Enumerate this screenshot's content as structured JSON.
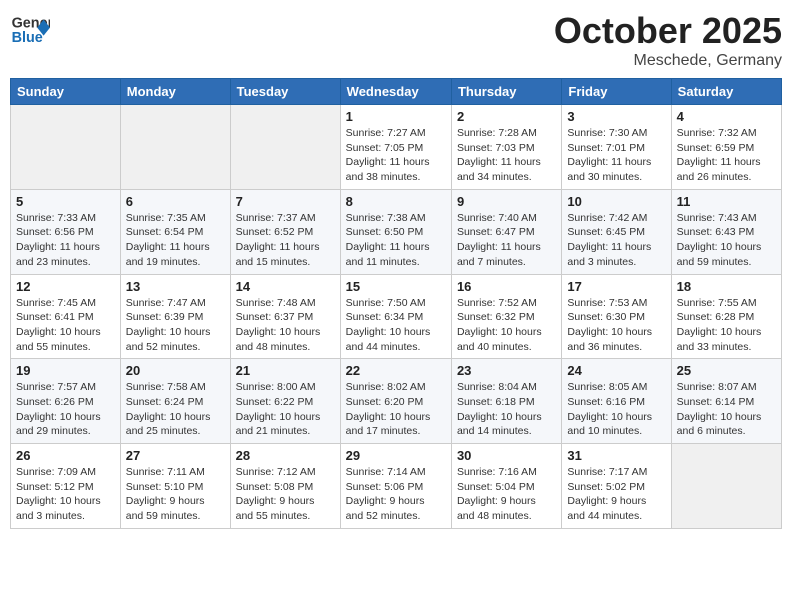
{
  "header": {
    "logo_general": "General",
    "logo_blue": "Blue",
    "month": "October 2025",
    "location": "Meschede, Germany"
  },
  "days_of_week": [
    "Sunday",
    "Monday",
    "Tuesday",
    "Wednesday",
    "Thursday",
    "Friday",
    "Saturday"
  ],
  "weeks": [
    [
      {
        "day": "",
        "info": ""
      },
      {
        "day": "",
        "info": ""
      },
      {
        "day": "",
        "info": ""
      },
      {
        "day": "1",
        "info": "Sunrise: 7:27 AM\nSunset: 7:05 PM\nDaylight: 11 hours\nand 38 minutes."
      },
      {
        "day": "2",
        "info": "Sunrise: 7:28 AM\nSunset: 7:03 PM\nDaylight: 11 hours\nand 34 minutes."
      },
      {
        "day": "3",
        "info": "Sunrise: 7:30 AM\nSunset: 7:01 PM\nDaylight: 11 hours\nand 30 minutes."
      },
      {
        "day": "4",
        "info": "Sunrise: 7:32 AM\nSunset: 6:59 PM\nDaylight: 11 hours\nand 26 minutes."
      }
    ],
    [
      {
        "day": "5",
        "info": "Sunrise: 7:33 AM\nSunset: 6:56 PM\nDaylight: 11 hours\nand 23 minutes."
      },
      {
        "day": "6",
        "info": "Sunrise: 7:35 AM\nSunset: 6:54 PM\nDaylight: 11 hours\nand 19 minutes."
      },
      {
        "day": "7",
        "info": "Sunrise: 7:37 AM\nSunset: 6:52 PM\nDaylight: 11 hours\nand 15 minutes."
      },
      {
        "day": "8",
        "info": "Sunrise: 7:38 AM\nSunset: 6:50 PM\nDaylight: 11 hours\nand 11 minutes."
      },
      {
        "day": "9",
        "info": "Sunrise: 7:40 AM\nSunset: 6:47 PM\nDaylight: 11 hours\nand 7 minutes."
      },
      {
        "day": "10",
        "info": "Sunrise: 7:42 AM\nSunset: 6:45 PM\nDaylight: 11 hours\nand 3 minutes."
      },
      {
        "day": "11",
        "info": "Sunrise: 7:43 AM\nSunset: 6:43 PM\nDaylight: 10 hours\nand 59 minutes."
      }
    ],
    [
      {
        "day": "12",
        "info": "Sunrise: 7:45 AM\nSunset: 6:41 PM\nDaylight: 10 hours\nand 55 minutes."
      },
      {
        "day": "13",
        "info": "Sunrise: 7:47 AM\nSunset: 6:39 PM\nDaylight: 10 hours\nand 52 minutes."
      },
      {
        "day": "14",
        "info": "Sunrise: 7:48 AM\nSunset: 6:37 PM\nDaylight: 10 hours\nand 48 minutes."
      },
      {
        "day": "15",
        "info": "Sunrise: 7:50 AM\nSunset: 6:34 PM\nDaylight: 10 hours\nand 44 minutes."
      },
      {
        "day": "16",
        "info": "Sunrise: 7:52 AM\nSunset: 6:32 PM\nDaylight: 10 hours\nand 40 minutes."
      },
      {
        "day": "17",
        "info": "Sunrise: 7:53 AM\nSunset: 6:30 PM\nDaylight: 10 hours\nand 36 minutes."
      },
      {
        "day": "18",
        "info": "Sunrise: 7:55 AM\nSunset: 6:28 PM\nDaylight: 10 hours\nand 33 minutes."
      }
    ],
    [
      {
        "day": "19",
        "info": "Sunrise: 7:57 AM\nSunset: 6:26 PM\nDaylight: 10 hours\nand 29 minutes."
      },
      {
        "day": "20",
        "info": "Sunrise: 7:58 AM\nSunset: 6:24 PM\nDaylight: 10 hours\nand 25 minutes."
      },
      {
        "day": "21",
        "info": "Sunrise: 8:00 AM\nSunset: 6:22 PM\nDaylight: 10 hours\nand 21 minutes."
      },
      {
        "day": "22",
        "info": "Sunrise: 8:02 AM\nSunset: 6:20 PM\nDaylight: 10 hours\nand 17 minutes."
      },
      {
        "day": "23",
        "info": "Sunrise: 8:04 AM\nSunset: 6:18 PM\nDaylight: 10 hours\nand 14 minutes."
      },
      {
        "day": "24",
        "info": "Sunrise: 8:05 AM\nSunset: 6:16 PM\nDaylight: 10 hours\nand 10 minutes."
      },
      {
        "day": "25",
        "info": "Sunrise: 8:07 AM\nSunset: 6:14 PM\nDaylight: 10 hours\nand 6 minutes."
      }
    ],
    [
      {
        "day": "26",
        "info": "Sunrise: 7:09 AM\nSunset: 5:12 PM\nDaylight: 10 hours\nand 3 minutes."
      },
      {
        "day": "27",
        "info": "Sunrise: 7:11 AM\nSunset: 5:10 PM\nDaylight: 9 hours\nand 59 minutes."
      },
      {
        "day": "28",
        "info": "Sunrise: 7:12 AM\nSunset: 5:08 PM\nDaylight: 9 hours\nand 55 minutes."
      },
      {
        "day": "29",
        "info": "Sunrise: 7:14 AM\nSunset: 5:06 PM\nDaylight: 9 hours\nand 52 minutes."
      },
      {
        "day": "30",
        "info": "Sunrise: 7:16 AM\nSunset: 5:04 PM\nDaylight: 9 hours\nand 48 minutes."
      },
      {
        "day": "31",
        "info": "Sunrise: 7:17 AM\nSunset: 5:02 PM\nDaylight: 9 hours\nand 44 minutes."
      },
      {
        "day": "",
        "info": ""
      }
    ]
  ]
}
